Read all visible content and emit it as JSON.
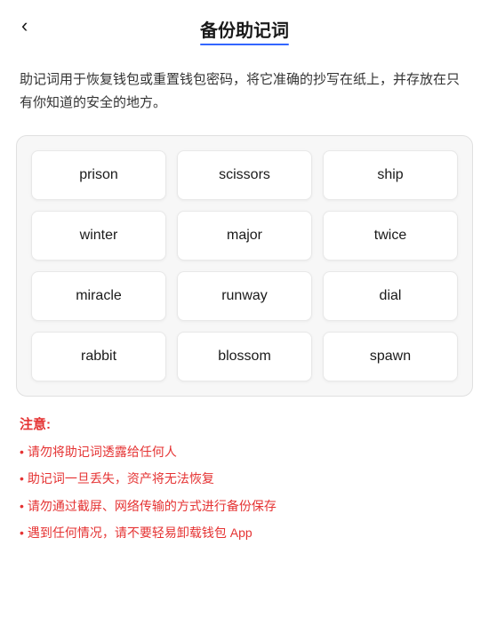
{
  "header": {
    "back_label": "‹",
    "title": "备份助记词"
  },
  "description": "助记词用于恢复钱包或重置钱包密码，将它准确的抄写在纸上，并存放在只有你知道的安全的地方。",
  "mnemonic_grid": {
    "words": [
      "prison",
      "scissors",
      "ship",
      "winter",
      "major",
      "twice",
      "miracle",
      "runway",
      "dial",
      "rabbit",
      "blossom",
      "spawn"
    ]
  },
  "notice": {
    "title": "注意:",
    "items": [
      "请勿将助记词透露给任何人",
      "助记词一旦丢失，资产将无法恢复",
      "请勿通过截屏、网络传输的方式进行备份保存",
      "遇到任何情况，请不要轻易卸载钱包 App"
    ]
  }
}
